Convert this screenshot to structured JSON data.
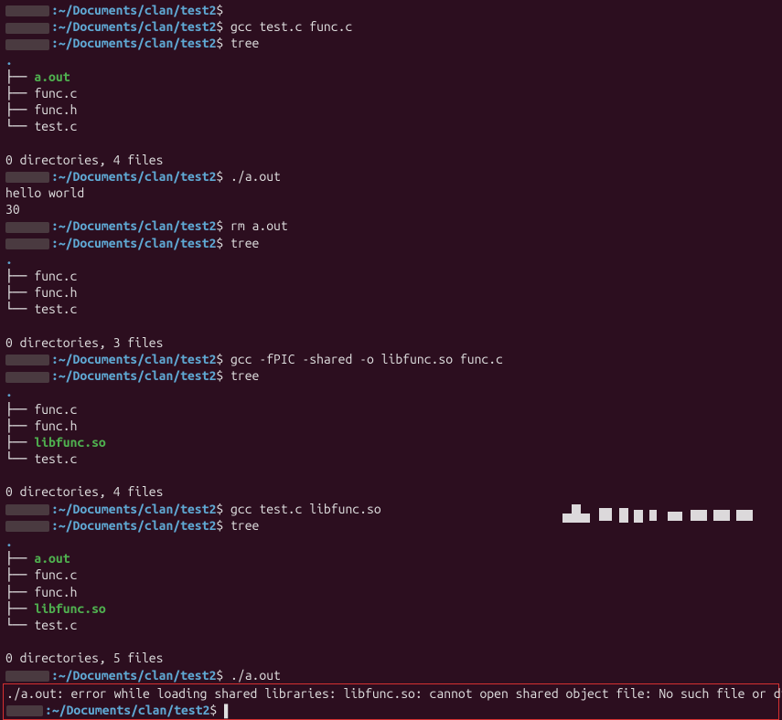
{
  "path": "~/Documents/clan/test2",
  "prompt": "$",
  "commands": {
    "c1_gcc_compile": "gcc test.c func.c",
    "c2_tree": "tree",
    "c3_run": "./a.out",
    "c4_rm": "rm a.out",
    "c5_tree": "tree",
    "c6_gcc_shared": "gcc -fPIC -shared -o libfunc.so func.c",
    "c7_tree": "tree",
    "c8_gcc_link": "gcc test.c libfunc.so",
    "c9_tree": "tree",
    "c10_run": "./a.out"
  },
  "output": {
    "hello": "hello world",
    "thirty": "30"
  },
  "files": {
    "aout": "a.out",
    "funcc": "func.c",
    "funch": "func.h",
    "testc": "test.c",
    "libfunc": "libfunc.so"
  },
  "tree": {
    "branch": "├── ",
    "last": "└── "
  },
  "summary": {
    "s1": "0 directories, 4 files",
    "s2": "0 directories, 3 files",
    "s3": "0 directories, 4 files",
    "s4": "0 directories, 5 files"
  },
  "error": "./a.out: error while loading shared libraries: libfunc.so: cannot open shared object file: No such file or directory"
}
